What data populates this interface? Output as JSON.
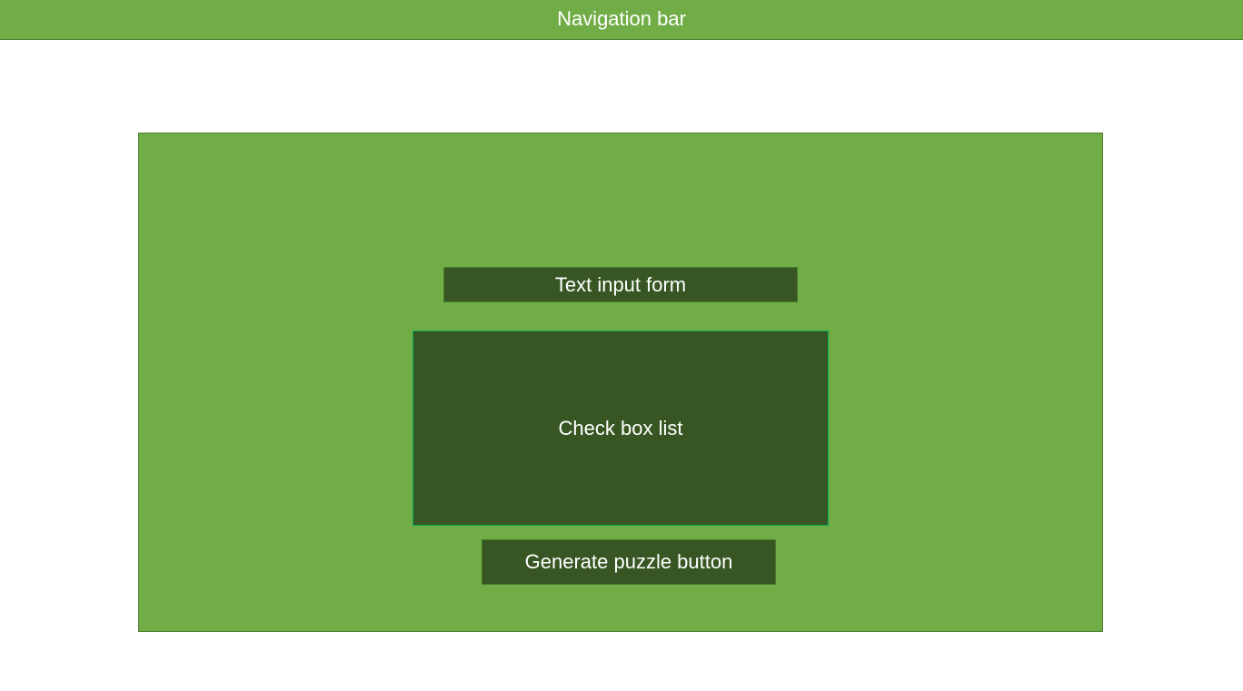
{
  "nav": {
    "label": "Navigation bar"
  },
  "main": {
    "text_input_label": "Text input form",
    "check_box_list_label": "Check box list",
    "generate_button_label": "Generate puzzle button"
  },
  "colors": {
    "light_green": "#70ad47",
    "dark_green": "#375623",
    "list_border": "#00b050",
    "text": "#ffffff"
  }
}
